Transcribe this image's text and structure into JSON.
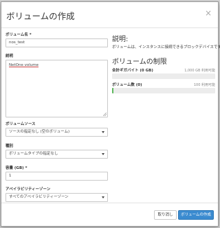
{
  "modal": {
    "title": "ボリュームの作成",
    "close_glyph": "×"
  },
  "form": {
    "volume_name": {
      "label": "ボリューム名",
      "required_mark": "*",
      "value": "nos_test"
    },
    "description": {
      "label": "説明",
      "value": "NetOne volume"
    },
    "volume_source": {
      "label": "ボリュームソース",
      "selected": "ソースの指定なし (空のボリューム)"
    },
    "type": {
      "label": "種別",
      "selected": "ボリュームタイプの指定なし"
    },
    "size": {
      "label": "容量 (GB)",
      "required_mark": "*",
      "value": "1"
    },
    "availability_zone": {
      "label": "アベイラビリティーゾーン",
      "selected": "すべてのアベイラビリティーゾーン"
    }
  },
  "info": {
    "desc_title": "説明:",
    "desc_text": "ボリュームは、インスタンスに接続できるブロックデバイスです。",
    "limits_title": "ボリュームの制限",
    "gigabytes": {
      "label": "合計ギガバイト (0 GB)",
      "value_text": "1,000 GB 利用可能",
      "used_fraction": 0.0
    },
    "volumes": {
      "label": "ボリューム数 (0)",
      "value_text": "100 利用可能",
      "used_fraction": 0.01
    }
  },
  "footer": {
    "cancel_label": "取り消し",
    "submit_label": "ボリュームの作成"
  },
  "colors": {
    "primary": "#3b8bd0",
    "quota_fill": "#5cb85c"
  }
}
